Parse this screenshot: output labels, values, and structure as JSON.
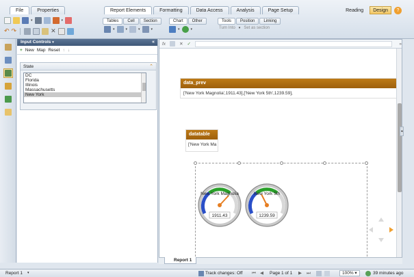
{
  "ribbon": {
    "left_tabs": [
      "File",
      "Properties"
    ],
    "main_tabs": [
      "Report Elements",
      "Formatting",
      "Data Access",
      "Analysis",
      "Page Setup"
    ],
    "modes": [
      "Reading",
      "Design"
    ],
    "subtabs_a": [
      "Tables",
      "Cell",
      "Section"
    ],
    "subtabs_b": [
      "Chart",
      "Other"
    ],
    "subtabs_c": [
      "Tools",
      "Position",
      "Linking"
    ],
    "turn_into": "Turn Into",
    "set_as_section": "Set as section"
  },
  "input_controls": {
    "title": "Input Controls",
    "new_label": "New",
    "map_label": "Map",
    "reset_label": "Reset",
    "state_title": "State",
    "options": [
      "DC",
      "Florida",
      "Illinois",
      "Massachusetts",
      "New York"
    ],
    "selected": "New York"
  },
  "formula_bar": {
    "fx": "fx"
  },
  "canvas": {
    "data_prev_title": "data_prev",
    "data_prev_text": "['New York Magnolia',1911.43],['New York 5th',1239.59],",
    "datatable_title": "datatable",
    "datatable_text": "['New York Ma",
    "gauges": [
      {
        "label": "New York Magnolia",
        "value": "1911.43"
      },
      {
        "label": "New York 5th",
        "value": "1239.59"
      }
    ]
  },
  "report_tab": "Report 1",
  "status": {
    "report": "Report 1",
    "track_changes": "Track changes: Off",
    "page": "Page 1 of 1",
    "zoom": "100%",
    "time": "39 minutes ago"
  },
  "colors": {
    "accent": "#b27014",
    "header_blue": "#4a6283",
    "gauge_green": "#2aa02a",
    "gauge_blue": "#2a4fc8"
  }
}
